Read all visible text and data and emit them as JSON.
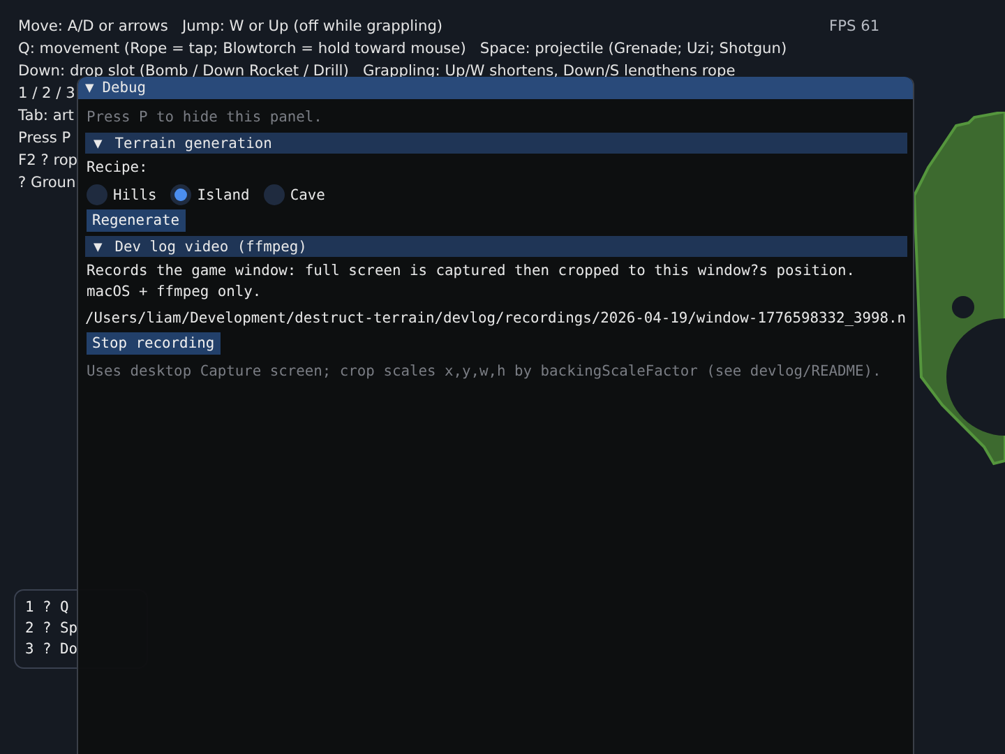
{
  "hud": {
    "lines": [
      "Move: A/D or arrows   Jump: W or Up (off while grappling)",
      "Q: movement (Rope = tap; Blowtorch = hold toward mouse)   Space: projectile (Grenade; Uzi; Shotgun)",
      "Down: drop slot (Bomb / Down Rocket / Drill)   Grappling: Up/W shortens, Down/S lengthens rope",
      "1 / 2 / 3",
      "Tab: art",
      "Press P",
      "F2 ? rop",
      "? Groun"
    ],
    "fps": "FPS 61"
  },
  "hotbar": [
    {
      "key": "1 ? Q"
    },
    {
      "key": "2 ? Sp"
    },
    {
      "key": "3 ? Do"
    }
  ],
  "debug_panel": {
    "toggle": "▼",
    "title": "Debug",
    "hint": "Press P to hide this panel.",
    "sections": [
      {
        "kind": "terrain",
        "toggle": "▼",
        "title": "Terrain generation",
        "label": "Recipe:",
        "options": [
          {
            "label": "Hills",
            "selected": false
          },
          {
            "label": "Island",
            "selected": true
          },
          {
            "label": "Cave",
            "selected": false
          }
        ],
        "button": "Regenerate"
      },
      {
        "kind": "devlog",
        "toggle": "▼",
        "title": "Dev log video (ffmpeg)",
        "lines": [
          "Records the game window: full screen is captured then cropped to this window?s position.",
          "macOS + ffmpeg only."
        ],
        "path": "/Users/liam/Development/destruct-terrain/devlog/recordings/2026-04-19/window-1776598332_3998.n",
        "button": "Stop recording",
        "note": "Uses desktop Capture screen; crop scales x,y,w,h by backingScaleFactor (see devlog/README)."
      }
    ]
  }
}
